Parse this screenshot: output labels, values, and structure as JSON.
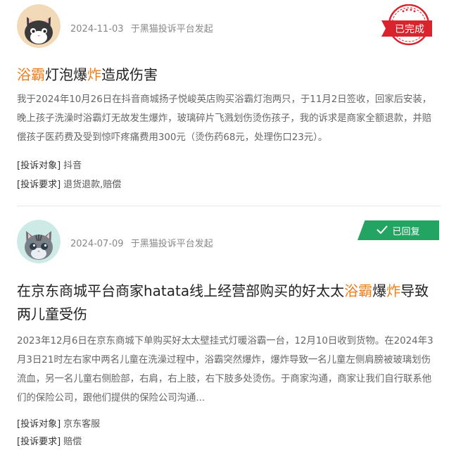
{
  "complaints": [
    {
      "date": "2024-11-03",
      "source": "于黑猫投诉平台发起",
      "status": "已完成",
      "title_parts": [
        "浴霸",
        "灯泡爆",
        "炸",
        "造成伤害"
      ],
      "description": "我于2024年10月26日在抖音商城扬子悦峻英店购买浴霸灯泡两只，于11月2日签收，回家后安装，晚上孩子洗澡时浴霸灯无故发生爆炸，玻璃碎片飞溅划伤烫伤孩子，我的诉求是商家全额退款，并赔偿孩子医药费及受到惊吓疼痛费用300元（烫伤药68元，处理伤口23元）。",
      "target_label": "[投诉对象]",
      "target_value": "抖音",
      "demand_label": "[投诉要求]",
      "demand_value": "退货退款,赔偿"
    },
    {
      "date": "2024-07-09",
      "source": "于黑猫投诉平台发起",
      "status": "已回复",
      "title_parts": [
        "在京东商城平台商家hatata线上经营部购买的好太太",
        "浴霸",
        "爆",
        "炸",
        "导致两儿童受伤"
      ],
      "description": "2023年12月6日在京东商城下单购买好太太壁挂式灯暖浴霸一台，12月10日收到货物。在2024年3月3日21时左右家中两名儿童在洗澡过程中，浴霸突然爆炸，爆炸导致一名儿童左侧肩膀被玻璃划伤流血，另一名儿童右侧脸部，右肩，右上肢，右下肢多处烫伤。于商家沟通，商家让我们自行联系他们的保险公司，跟他们提供的保险公司沟通...",
      "target_label": "[投诉对象]",
      "target_value": "京东客服",
      "demand_label": "[投诉要求]",
      "demand_value": "赔偿"
    }
  ],
  "icons": {
    "avatar1": "cat-avatar-icon",
    "avatar2": "cat-avatar-icon",
    "stamp": "completed-stamp-icon",
    "check": "check-icon"
  },
  "colors": {
    "highlight": "#ef7d1a",
    "stamp_red": "#d9232d",
    "replied_green": "#23a463"
  }
}
